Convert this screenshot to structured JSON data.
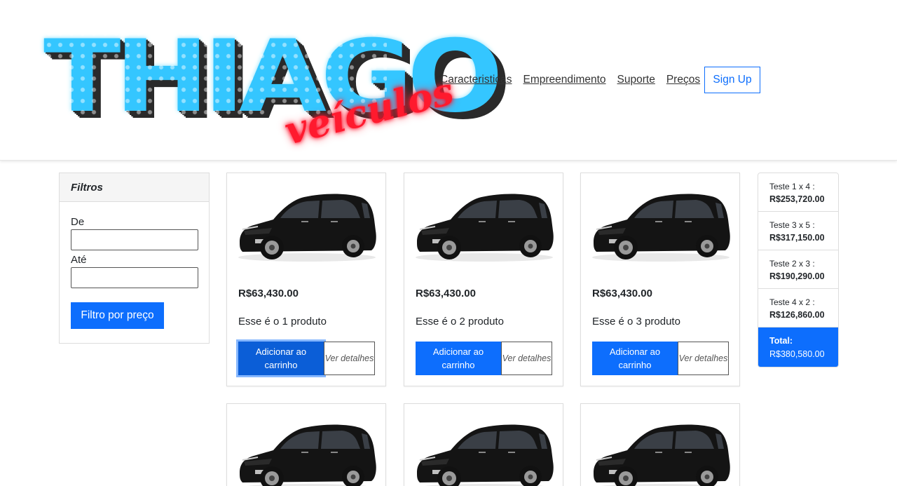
{
  "header": {
    "logo_main": "THIAGO",
    "logo_script": "veículos",
    "nav": [
      "Caracteristicas",
      "Empreendimento",
      "Suporte",
      "Preços"
    ],
    "signup": "Sign Up"
  },
  "filters": {
    "title": "Filtros",
    "from_label": "De",
    "to_label": "Até",
    "from_value": "",
    "to_value": "",
    "button": "Filtro por preço"
  },
  "products": [
    {
      "price": "R$63,430.00",
      "desc": "Esse é o 1 produto",
      "add": "Adicionar ao carrinho",
      "view": "Ver detalhes"
    },
    {
      "price": "R$63,430.00",
      "desc": "Esse é o 2 produto",
      "add": "Adicionar ao carrinho",
      "view": "Ver detalhes"
    },
    {
      "price": "R$63,430.00",
      "desc": "Esse é o 3 produto",
      "add": "Adicionar ao carrinho",
      "view": "Ver detalhes"
    }
  ],
  "cart": {
    "items": [
      {
        "label": "Teste 1 x 4 :",
        "amount": "R$253,720.00"
      },
      {
        "label": "Teste 3 x 5 :",
        "amount": "R$317,150.00"
      },
      {
        "label": "Teste 2 x 3 :",
        "amount": "R$190,290.00"
      },
      {
        "label": "Teste 4 x 2 :",
        "amount": "R$126,860.00"
      }
    ],
    "total_label": "Total:",
    "total_amount": "R$380,580.00"
  },
  "colors": {
    "accent": "#0d6efd",
    "logo_blue": "#34c6ff",
    "logo_red": "#ff1a2e"
  }
}
